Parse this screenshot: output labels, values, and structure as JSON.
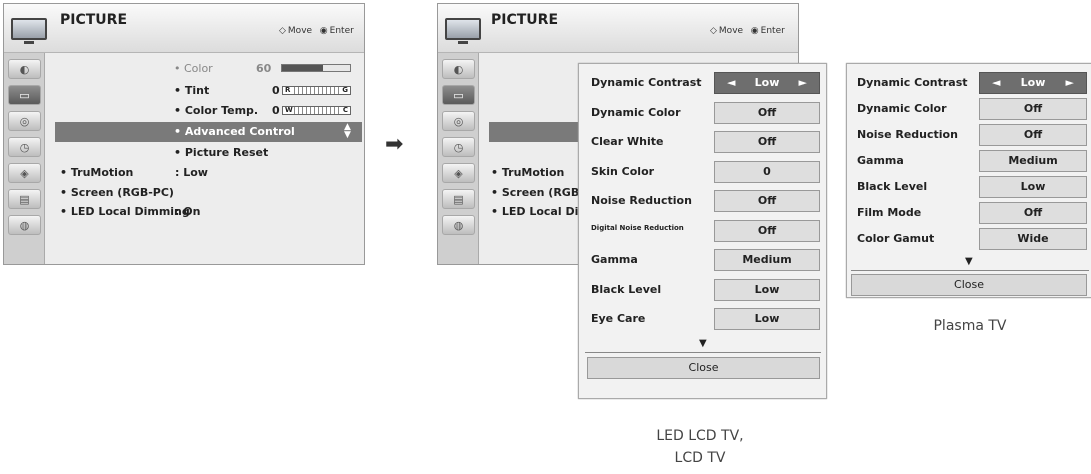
{
  "menu1": {
    "title": "PICTURE",
    "hint_move": "Move",
    "hint_enter": "Enter",
    "color_label": "• Color",
    "color_value": "60",
    "color_level": 0.6,
    "tint_label": "• Tint",
    "tint_value": "0",
    "tint_left": "R",
    "tint_right": "G",
    "colortemp_label": "• Color Temp.",
    "colortemp_value": "0",
    "colortemp_left": "W",
    "colortemp_right": "C",
    "advanced_label": "• Advanced Control",
    "reset_label": "• Picture Reset",
    "trumotion_label": "• TruMotion",
    "trumotion_value": ": Low",
    "screen_label": "• Screen (RGB-PC)",
    "led_label": "• LED Local Dimming",
    "led_value": ": On"
  },
  "menu2": {
    "title": "PICTURE",
    "hint_move": "Move",
    "hint_enter": "Enter",
    "trumotion_label": "• TruMotion",
    "screen_label": "• Screen (RGB-",
    "led_label": "• LED Local Dim"
  },
  "panel_led": {
    "rows": [
      {
        "label": "Dynamic Contrast",
        "value": "Low"
      },
      {
        "label": "Dynamic Color",
        "value": "Off"
      },
      {
        "label": "Clear White",
        "value": "Off"
      },
      {
        "label": "Skin Color",
        "value": "0"
      },
      {
        "label": "Noise Reduction",
        "value": "Off"
      },
      {
        "label": "Digital Noise Reduction",
        "value": "Off"
      },
      {
        "label": "Gamma",
        "value": "Medium"
      },
      {
        "label": "Black Level",
        "value": "Low"
      },
      {
        "label": "Eye Care",
        "value": "Low"
      }
    ],
    "close": "Close"
  },
  "panel_plasma": {
    "rows": [
      {
        "label": "Dynamic Contrast",
        "value": "Low"
      },
      {
        "label": "Dynamic Color",
        "value": "Off"
      },
      {
        "label": "Noise Reduction",
        "value": "Off"
      },
      {
        "label": "Gamma",
        "value": "Medium"
      },
      {
        "label": "Black Level",
        "value": "Low"
      },
      {
        "label": "Film Mode",
        "value": "Off"
      },
      {
        "label": "Color Gamut",
        "value": "Wide"
      }
    ],
    "close": "Close"
  },
  "captions": {
    "plasma": "Plasma TV",
    "led_line1": "LED LCD TV,",
    "led_line2": "LCD TV"
  },
  "icons": {
    "move": "◇",
    "enter": "◉",
    "left": "◄",
    "right": "►",
    "down": "▼",
    "arrow": "➡"
  }
}
